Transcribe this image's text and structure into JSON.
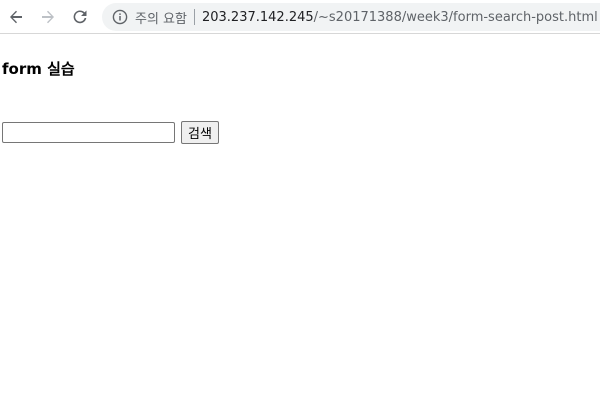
{
  "browser": {
    "security_label": "주의 요함",
    "url_host": "203.237.142.245",
    "url_path": "/~s20171388/week3/form-search-post.html",
    "icons": {
      "back": "arrow-left-icon",
      "forward": "arrow-right-icon",
      "reload": "reload-icon",
      "info": "info-icon"
    },
    "colors": {
      "icon_active": "#5f6368",
      "icon_disabled": "#bdc1c6",
      "omnibox_bg": "#f1f3f4"
    }
  },
  "page": {
    "title": "form 실습",
    "search": {
      "value": "",
      "button_label": "검색"
    }
  }
}
